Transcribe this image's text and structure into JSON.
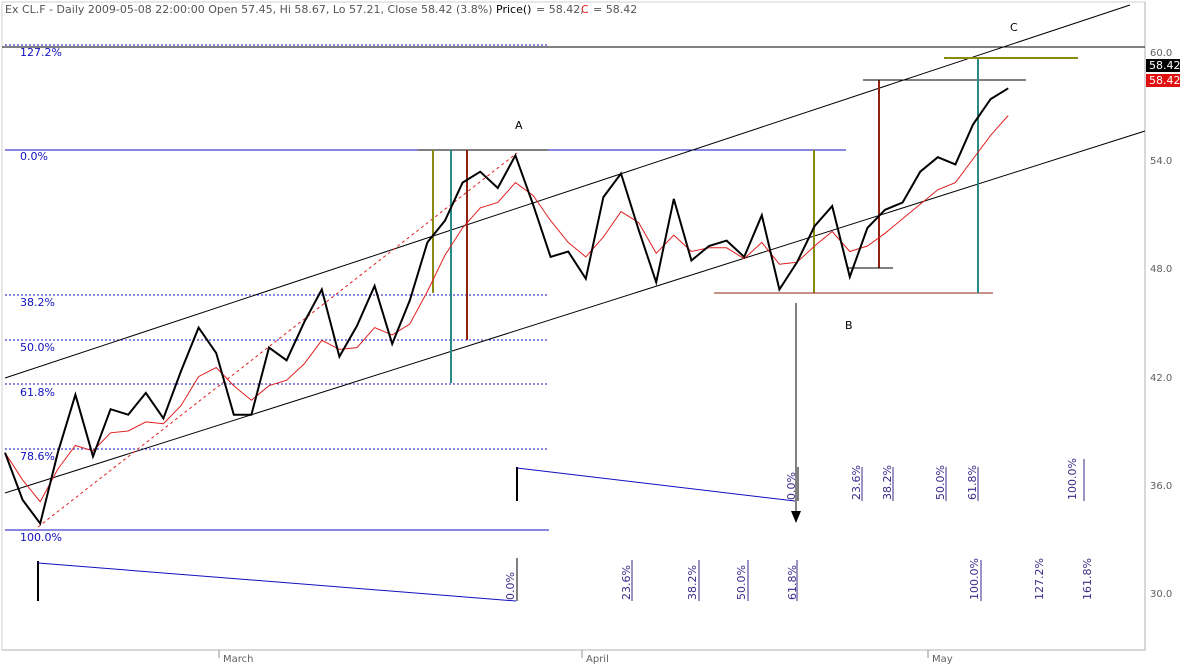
{
  "header": {
    "symbol_line": "Ex CL.F - Daily 2009-05-08 22:00:00 Open 57.45, Hi 58.67, Lo 57.21, Close 58.42 (3.8%)",
    "price_label": "Price()",
    "price_value": "= 58.42,",
    "c_label": "C",
    "c_value": "= 58.42"
  },
  "colors": {
    "price": "#000000",
    "average": "#e02020",
    "fib_lines": "#1010c0",
    "channel": "#000000",
    "olive": "#8a8a10",
    "teal": "#2a8a8a",
    "brown": "#902010",
    "price_tag_black": "#000000",
    "price_tag_red": "#e01010"
  },
  "chart_data": {
    "type": "line",
    "title": "",
    "ylim": [
      26.5,
      63.5
    ],
    "y_ticks": [
      "60.0",
      "54.0",
      "48.0",
      "42.0",
      "36.0",
      "30.0"
    ],
    "y_tick_values": [
      60,
      54,
      48,
      42,
      36,
      30
    ],
    "x_labels": [
      {
        "label": "March",
        "index": 14
      },
      {
        "label": "April",
        "index": 36
      },
      {
        "label": "May",
        "index": 58
      }
    ],
    "price_tags": [
      "58.42",
      "58.42"
    ],
    "series": [
      {
        "name": "Price()",
        "values": [
          37.9,
          35.3,
          34.0,
          37.9,
          41.1,
          37.7,
          40.3,
          40.0,
          41.2,
          39.8,
          42.4,
          44.8,
          43.4,
          40.0,
          40.0,
          43.7,
          43.0,
          45.1,
          46.9,
          43.2,
          44.9,
          47.1,
          43.9,
          46.3,
          49.5,
          50.7,
          52.8,
          53.4,
          52.5,
          54.3,
          51.6,
          48.7,
          49.0,
          47.5,
          52.0,
          53.3,
          50.2,
          47.3,
          51.9,
          48.5,
          49.3,
          49.6,
          48.7,
          51.0,
          46.9,
          48.4,
          50.4,
          51.5,
          47.6,
          50.3,
          51.3,
          51.7,
          53.4,
          54.2,
          53.8,
          56.0,
          57.4,
          58.0
        ]
      },
      {
        "name": "C",
        "values": [
          37.9,
          36.4,
          35.2,
          37.0,
          38.3,
          38.0,
          39.0,
          39.1,
          39.6,
          39.5,
          40.5,
          42.1,
          42.6,
          41.6,
          40.8,
          41.6,
          41.9,
          42.8,
          44.1,
          43.6,
          43.7,
          44.8,
          44.4,
          45.0,
          46.8,
          48.8,
          50.3,
          51.4,
          51.7,
          52.8,
          52.1,
          50.7,
          49.5,
          48.7,
          49.8,
          51.2,
          50.6,
          48.9,
          49.9,
          49.0,
          49.2,
          49.2,
          48.6,
          49.5,
          48.3,
          48.4,
          49.3,
          50.1,
          49.0,
          49.3,
          50.0,
          50.8,
          51.6,
          52.4,
          52.8,
          54.1,
          55.4,
          56.5
        ]
      }
    ]
  },
  "fib_levels": [
    "0.0%",
    "38.2%",
    "50.0%",
    "61.8%",
    "78.6%",
    "100.0%",
    "127.2%"
  ],
  "pattern_points": {
    "a": "A",
    "b": "B",
    "c": "C"
  },
  "time_zones_upper": [
    "0.0%",
    "23.6%",
    "38.2%",
    "50.0%",
    "61.8%",
    "100.0%"
  ],
  "time_zones_lower": [
    "0.0%",
    "23.6%",
    "38.2%",
    "50.0%",
    "61.8%",
    "100.0%",
    "127.2%",
    "161.8%"
  ]
}
